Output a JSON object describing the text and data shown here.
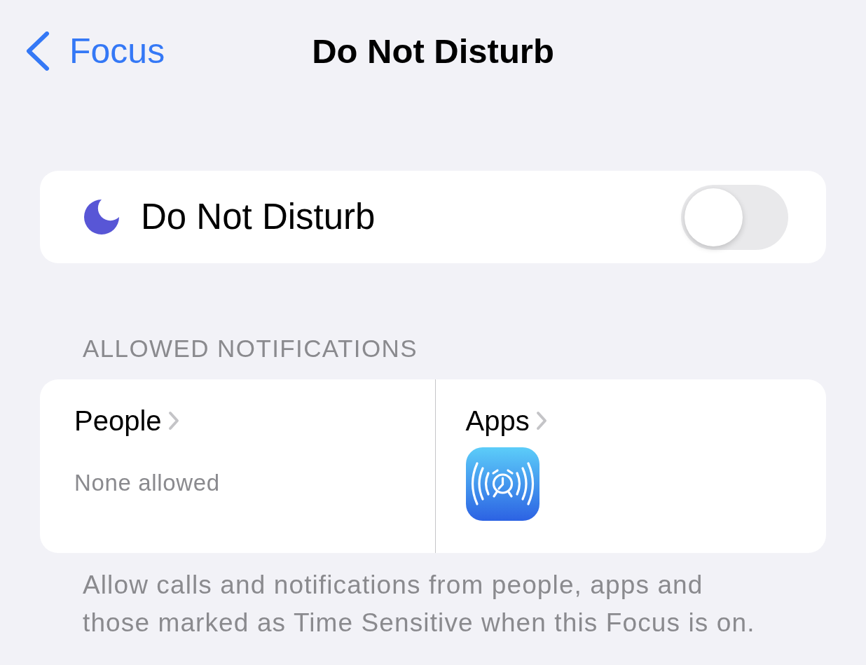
{
  "nav": {
    "back_label": "Focus",
    "title": "Do Not Disturb"
  },
  "focus_toggle": {
    "label": "Do Not Disturb",
    "on": false
  },
  "allowed_notifications": {
    "header": "ALLOWED NOTIFICATIONS",
    "columns": [
      {
        "kind": "people",
        "label": "People",
        "detail": "None allowed"
      },
      {
        "kind": "apps",
        "label": "Apps"
      }
    ]
  },
  "footer": "Allow calls and notifications from people, apps and those marked as Time Sensitive when this Focus is on."
}
